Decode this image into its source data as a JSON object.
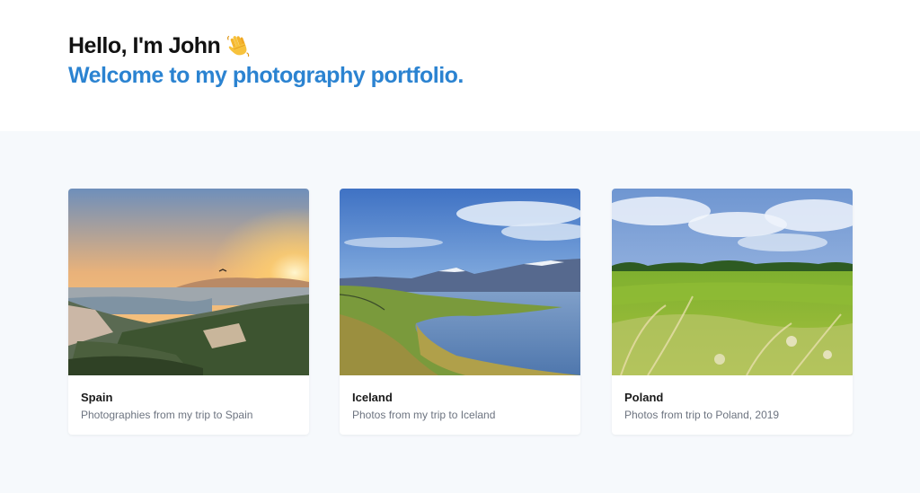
{
  "header": {
    "greeting": "Hello, I'm John",
    "greeting_emoji_icon": "waving-hand-icon",
    "headline": "Welcome to my photography portfolio."
  },
  "gallery": {
    "cards": [
      {
        "title": "Spain",
        "description": "Photographies from my trip to Spain",
        "photo_icon": "spain-city-sunset-photo"
      },
      {
        "title": "Iceland",
        "description": "Photos from my trip to Iceland",
        "photo_icon": "iceland-fjord-mountains-photo"
      },
      {
        "title": "Poland",
        "description": "Photos from trip to Poland, 2019",
        "photo_icon": "poland-green-meadow-photo"
      }
    ]
  },
  "colors": {
    "accent": "#2b83d1",
    "text": "#111111",
    "muted": "#6d7480",
    "gallery_bg": "#f6f9fc"
  }
}
